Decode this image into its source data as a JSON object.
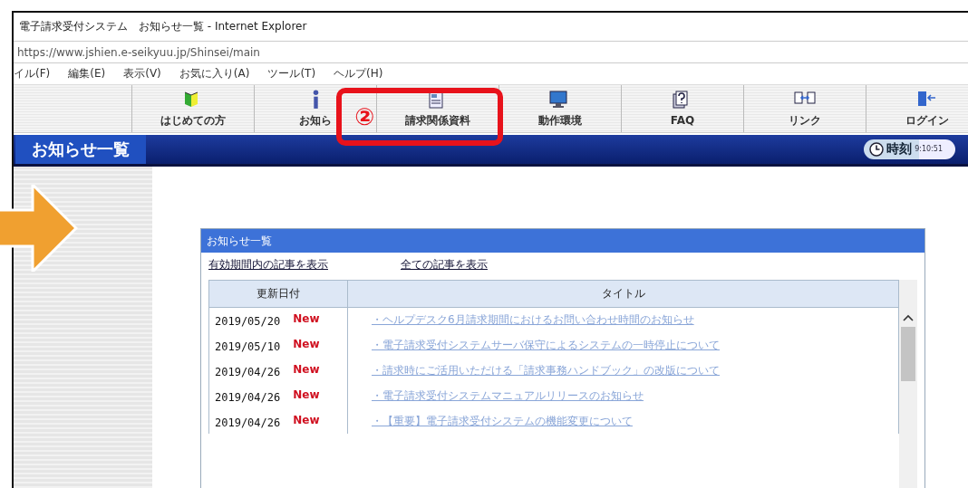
{
  "window": {
    "title": "電子請求受付システム　お知らせ一覧 - Internet Explorer",
    "address": "https://www.jshien.e-seikyuu.jp/Shinsei/main"
  },
  "menu": [
    "イル(F)",
    "編集(E)",
    "表示(V)",
    "お気に入り(A)",
    "ツール(T)",
    "ヘルプ(H)"
  ],
  "toolbar": [
    {
      "kind": "beginner",
      "label": "はじめての方",
      "highlighted": false
    },
    {
      "kind": "info",
      "label": "お知ら",
      "highlighted": false
    },
    {
      "kind": "document",
      "label": "請求関係資料",
      "highlighted": true
    },
    {
      "kind": "monitor",
      "label": "動作環境",
      "highlighted": false
    },
    {
      "kind": "faq",
      "label": "FAQ",
      "highlighted": false
    },
    {
      "kind": "link",
      "label": "リンク",
      "highlighted": false
    },
    {
      "kind": "login",
      "label": "ログイン",
      "highlighted": false
    }
  ],
  "annotation": {
    "step": "②"
  },
  "page_header": {
    "title": "お知らせ一覧",
    "clock_label": "時刻",
    "clock_time": "9:10:51"
  },
  "panel": {
    "title": "お知らせ一覧",
    "links": [
      "有効期間内の記事を表示",
      "全ての記事を表示"
    ],
    "columns": [
      "更新日付",
      "タイトル"
    ],
    "rows": [
      {
        "date": "2019/05/20",
        "badge": "New",
        "title": "・ヘルプデスク6月請求期間におけるお問い合わせ時間のお知らせ"
      },
      {
        "date": "2019/05/10",
        "badge": "New",
        "title": "・電子請求受付システムサーバ保守によるシステムの一時停止について"
      },
      {
        "date": "2019/04/26",
        "badge": "New",
        "title": "・請求時にご活用いただける「請求事務ハンドブック」の改版について"
      },
      {
        "date": "2019/04/26",
        "badge": "New",
        "title": "・電子請求受付システムマニュアルリリースのお知らせ"
      },
      {
        "date": "2019/04/26",
        "badge": "New",
        "title": "・【重要】電子請求受付システムの機能変更について"
      }
    ]
  }
}
